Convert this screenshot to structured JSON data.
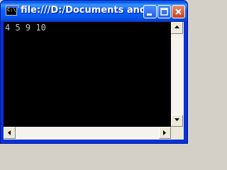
{
  "window": {
    "title": "file:///D:/Documents and ...",
    "system_icon_text": "C:\\",
    "icons": {
      "system": "console-icon",
      "minimize": "minimize-icon",
      "maximize": "maximize-icon",
      "close": "close-icon"
    }
  },
  "console": {
    "output": "4 5 9 10"
  },
  "scrollbars": {
    "icons": [
      "arrow-up-icon",
      "arrow-down-icon",
      "arrow-left-icon",
      "arrow-right-icon"
    ]
  },
  "colors": {
    "titlebar": "#0860ff",
    "console_bg": "#000000",
    "console_fg": "#c0c0c0",
    "close_button": "#c9421f"
  }
}
